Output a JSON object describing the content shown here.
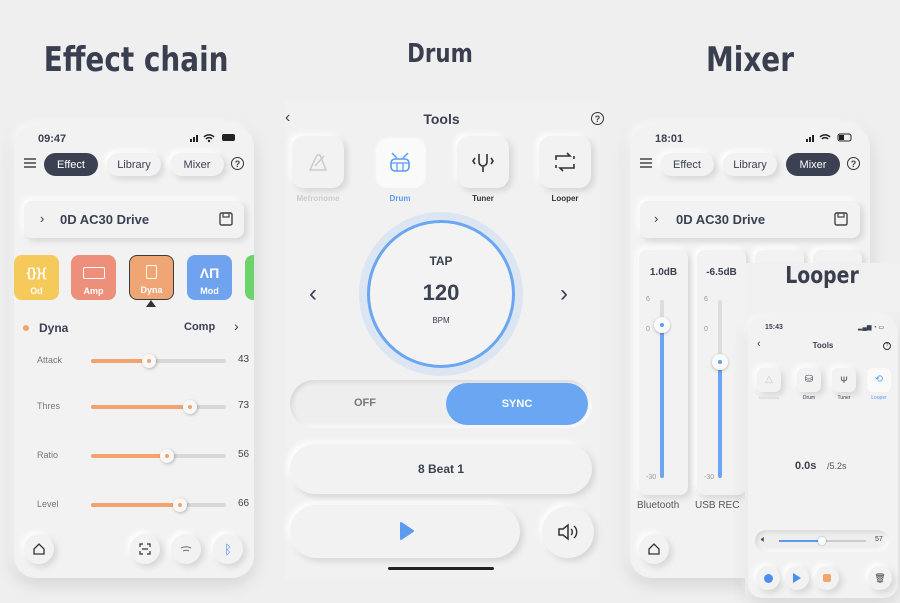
{
  "headings": {
    "effect_chain": "Effect chain",
    "drum": "Drum",
    "mixer": "Mixer",
    "looper": "Looper"
  },
  "colors": {
    "accent_blue": "#6aa6f2",
    "dark_tab": "#3b4152",
    "od": "#f5c95a",
    "amp": "#ee8f7b",
    "dyna": "#f0a574",
    "mod": "#6fa3ef",
    "next": "#6ad36a"
  },
  "effect_screen": {
    "time": "09:47",
    "tabs": [
      {
        "label": "Effect",
        "active": true
      },
      {
        "label": "Library",
        "active": false
      },
      {
        "label": "Mixer",
        "active": false
      }
    ],
    "preset": "0D AC30 Drive",
    "effects": [
      {
        "label": "Od"
      },
      {
        "label": "Amp"
      },
      {
        "label": "Dyna",
        "selected": true
      },
      {
        "label": "Mod"
      }
    ],
    "module_name": "Dyna",
    "module_type": "Comp",
    "params": [
      {
        "label": "Attack",
        "value": 43
      },
      {
        "label": "Thres",
        "value": 73
      },
      {
        "label": "Ratio",
        "value": 56
      },
      {
        "label": "Level",
        "value": 66
      }
    ]
  },
  "drum_screen": {
    "title": "Tools",
    "tools": [
      {
        "label": "Metronome",
        "state": "disabled"
      },
      {
        "label": "Drum",
        "state": "active"
      },
      {
        "label": "Tuner",
        "state": "normal"
      },
      {
        "label": "Looper",
        "state": "normal"
      }
    ],
    "tap_label": "TAP",
    "bpm": "120",
    "bpm_unit": "BPM",
    "sync_off": "OFF",
    "sync_on": "SYNC",
    "sync_state": "SYNC",
    "pattern": "8 Beat 1"
  },
  "mixer_screen": {
    "time": "18:01",
    "tabs": [
      {
        "label": "Effect",
        "active": false
      },
      {
        "label": "Library",
        "active": false
      },
      {
        "label": "Mixer",
        "active": true
      }
    ],
    "preset": "0D AC30 Drive",
    "scale": {
      "max": "6",
      "zero": "0",
      "min": "-30"
    },
    "channels": [
      {
        "name": "Bluetooth",
        "level": "1.0dB",
        "db": 1.0
      },
      {
        "name": "USB REC",
        "level": "-6.5dB",
        "db": -6.5
      }
    ]
  },
  "looper_screen": {
    "time": "15:43",
    "title": "Tools",
    "tools": [
      {
        "label": "Metronome"
      },
      {
        "label": "Drum"
      },
      {
        "label": "Tuner"
      },
      {
        "label": "Looper"
      }
    ],
    "position": "0.0s",
    "length": "/5.2s",
    "volume": 57
  }
}
